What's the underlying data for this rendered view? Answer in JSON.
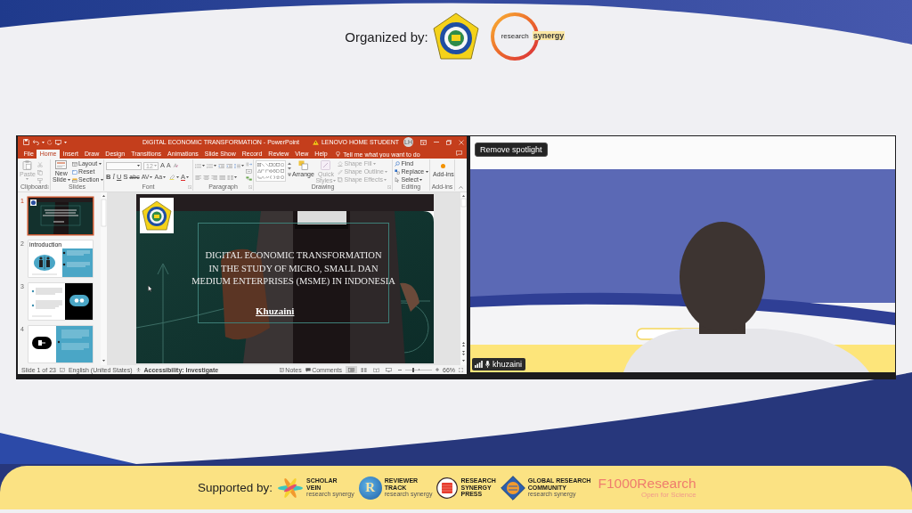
{
  "organizers": {
    "label": "Organized by:",
    "research_synergy_logo": {
      "center_word": "research",
      "side_word": "synergy"
    }
  },
  "presentation_window": {
    "title": "DIGITAL ECONOMIC TRANSFORMATION - PowerPoint",
    "account": "LENOVO HOME STUDENT",
    "avatar_initials": "LH",
    "tabs": [
      {
        "label": "File",
        "selected": false
      },
      {
        "label": "Home",
        "selected": true
      },
      {
        "label": "Insert",
        "selected": false
      },
      {
        "label": "Draw",
        "selected": false
      },
      {
        "label": "Design",
        "selected": false
      },
      {
        "label": "Transitions",
        "selected": false
      },
      {
        "label": "Animations",
        "selected": false
      },
      {
        "label": "Slide Show",
        "selected": false
      },
      {
        "label": "Record",
        "selected": false
      },
      {
        "label": "Review",
        "selected": false
      },
      {
        "label": "View",
        "selected": false
      },
      {
        "label": "Help",
        "selected": false
      }
    ],
    "tell_me": {
      "placeholder": "Tell me what you want to do"
    },
    "ribbon": [
      {
        "kind": "clipboard",
        "name": "Clipboard",
        "paste": {
          "label": "Paste",
          "disabled": true
        }
      },
      {
        "kind": "slides",
        "name": "Slides",
        "new_slide": {
          "lines": [
            "New",
            "Slide"
          ]
        },
        "commands": [
          {
            "label": "Layout",
            "dropdown": true
          },
          {
            "label": "Reset",
            "dropdown": false
          },
          {
            "label": "Section",
            "dropdown": true
          }
        ]
      },
      {
        "kind": "font",
        "name": "Font",
        "font_size": {
          "value": "12",
          "disabled": true
        },
        "size_buttons": [
          "A",
          "A"
        ],
        "style_buttons": [
          {
            "label": "B",
            "dropdown": false
          },
          {
            "label": "I",
            "dropdown": false
          },
          {
            "label": "U",
            "dropdown": false
          },
          {
            "label": "S",
            "dropdown": false
          },
          {
            "label": "abc",
            "dropdown": false
          },
          {
            "label": "AV",
            "dropdown": true
          },
          {
            "label": "Aa",
            "dropdown": true
          }
        ],
        "color_button": "A"
      },
      {
        "kind": "paragraph",
        "name": "Paragraph"
      },
      {
        "kind": "drawing",
        "name": "Drawing",
        "arrange": "Arrange",
        "quick_styles": {
          "lines": [
            "Quick",
            "Styles"
          ],
          "disabled": true
        },
        "shape_commands": [
          {
            "label": "Shape Fill",
            "disabled": true
          },
          {
            "label": "Shape Outline",
            "disabled": true
          },
          {
            "label": "Shape Effects",
            "disabled": true
          }
        ]
      },
      {
        "kind": "editing",
        "name": "Editing",
        "commands": [
          {
            "label": "Find",
            "dropdown": false
          },
          {
            "label": "Replace",
            "dropdown": true
          },
          {
            "label": "Select",
            "dropdown": true
          }
        ]
      },
      {
        "kind": "addins",
        "name": "Add-ins",
        "button": "Add-ins"
      }
    ],
    "thumbnails": [
      {
        "number": "1",
        "kind": "title",
        "selected": true
      },
      {
        "number": "2",
        "kind": "introduction",
        "heading": "introduction",
        "selected": false
      },
      {
        "number": "3",
        "kind": "text_image",
        "selected": false
      },
      {
        "number": "4",
        "kind": "icon_text",
        "selected": false
      }
    ],
    "slide": {
      "title_lines": [
        "DIGITAL ECONOMIC TRANSFORMATION",
        "IN THE STUDY OF MICRO, SMALL DAN",
        "MEDIUM ENTERPRISES (MSME) IN INDONESIA"
      ],
      "author": "Khuzaini"
    },
    "status_bar": {
      "slide_position": "Slide 1 of 23",
      "language": "English (United States)",
      "accessibility": "Accessibility: Investigate",
      "notes": "Notes",
      "comments": "Comments",
      "views": [
        {
          "selected": true
        },
        {
          "selected": false
        },
        {
          "selected": false
        },
        {
          "selected": false
        }
      ],
      "zoom": {
        "level": 0.3,
        "reading": "66%"
      }
    }
  },
  "video_tile": {
    "spotlight_button": "Remove spotlight",
    "participant_name": "khuzaini"
  },
  "supporters": {
    "label": "Supported by:",
    "logos": [
      {
        "kind": "scholar_vein",
        "lines": [
          "SCHOLAR",
          "VEIN"
        ],
        "byline": "research synergy"
      },
      {
        "kind": "reviewer_track",
        "monogram": "R",
        "lines": [
          "REVIEWER",
          "TRACK"
        ],
        "byline": "research synergy"
      },
      {
        "kind": "press",
        "lines": [
          "RESEARCH",
          "SYNERGY",
          "PRESS"
        ]
      },
      {
        "kind": "global_community",
        "lines": [
          "GLOBAL RESEARCH",
          "COMMUNITY"
        ],
        "byline": "research synergy"
      },
      {
        "kind": "f1000",
        "name": "F1000Research",
        "tagline": "Open for Science"
      }
    ]
  }
}
